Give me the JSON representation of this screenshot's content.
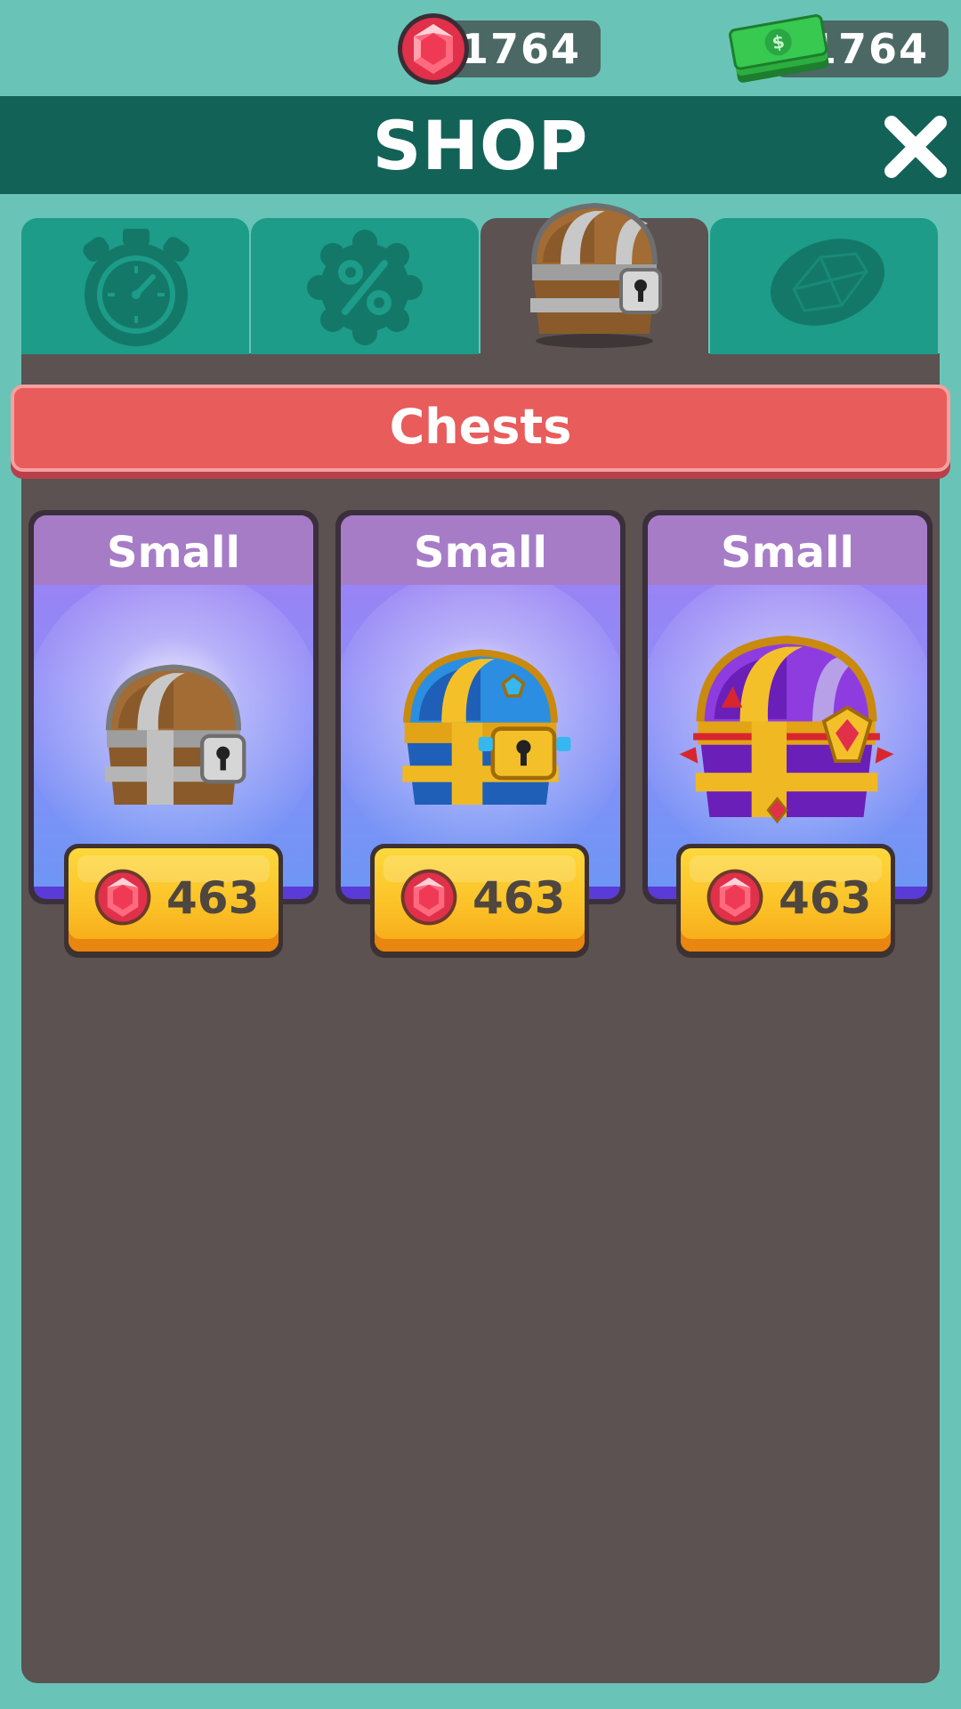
{
  "currencies": {
    "gems": {
      "amount": "1764",
      "icon": "ruby-gem-icon"
    },
    "cash": {
      "amount": "1764",
      "icon": "cash-stack-icon"
    }
  },
  "header": {
    "title": "SHOP",
    "close_icon": "close-icon"
  },
  "tabs": [
    {
      "icon": "stopwatch-icon",
      "active": false
    },
    {
      "icon": "discount-badge-icon",
      "active": false
    },
    {
      "icon": "chest-icon",
      "active": true
    },
    {
      "icon": "gem-icon",
      "active": false
    }
  ],
  "section": {
    "title": "Chests"
  },
  "chests": [
    {
      "name": "Small",
      "price": "463",
      "style": "silver-wood"
    },
    {
      "name": "Small",
      "price": "463",
      "style": "gold-blue"
    },
    {
      "name": "Small",
      "price": "463",
      "style": "gold-purple"
    }
  ],
  "colors": {
    "background": "#69c4b7",
    "header": "#136257",
    "tab": "#1c9c89",
    "panel": "#5b5251",
    "banner": "#e85c5c",
    "card_title": "#a67cc7",
    "button": "#fbc228"
  }
}
